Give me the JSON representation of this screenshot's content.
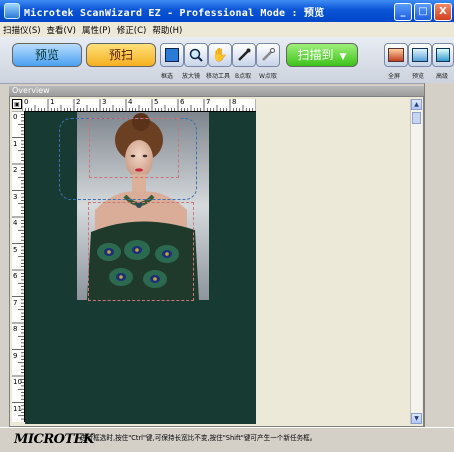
{
  "window": {
    "title": "Microtek ScanWizard EZ - Professional Mode : 预览"
  },
  "window_buttons": {
    "minimize": "_",
    "maximize": "□",
    "close": "X"
  },
  "menu": [
    "扫描仪(S)",
    "查看(V)",
    "属性(P)",
    "修正(C)",
    "帮助(H)"
  ],
  "toolbar": {
    "preview_label": "预览",
    "scan_label": "预扫",
    "scan_to_label": "扫描到",
    "scan_to_arrow": "▼",
    "tools": [
      {
        "name": "框选",
        "icon": "marquee-icon"
      },
      {
        "name": "放大镜",
        "icon": "magnifier-icon"
      },
      {
        "name": "移动工具",
        "icon": "hand-icon"
      },
      {
        "name": "B点取",
        "icon": "black-eyedropper-icon"
      },
      {
        "name": "W点取",
        "icon": "white-eyedropper-icon"
      }
    ],
    "right_tools": [
      {
        "name": "全屏",
        "icon": "fullscreen-icon"
      },
      {
        "name": "预览",
        "icon": "preview-icon"
      },
      {
        "name": "高级",
        "icon": "advanced-icon"
      }
    ]
  },
  "overview": {
    "header": "Overview",
    "ruler_h": [
      "0",
      "1",
      "2",
      "3",
      "4",
      "5",
      "6",
      "7",
      "8"
    ],
    "ruler_v": [
      "0",
      "1",
      "2",
      "3",
      "4",
      "5",
      "6",
      "7",
      "8",
      "9",
      "10",
      "11"
    ]
  },
  "status": {
    "logo": "MICROTEK",
    "text": "进行框选时,按住\"Ctrl\"键,可保持长宽比不变,按住\"Shift\"键可产生一个新任务框。"
  }
}
